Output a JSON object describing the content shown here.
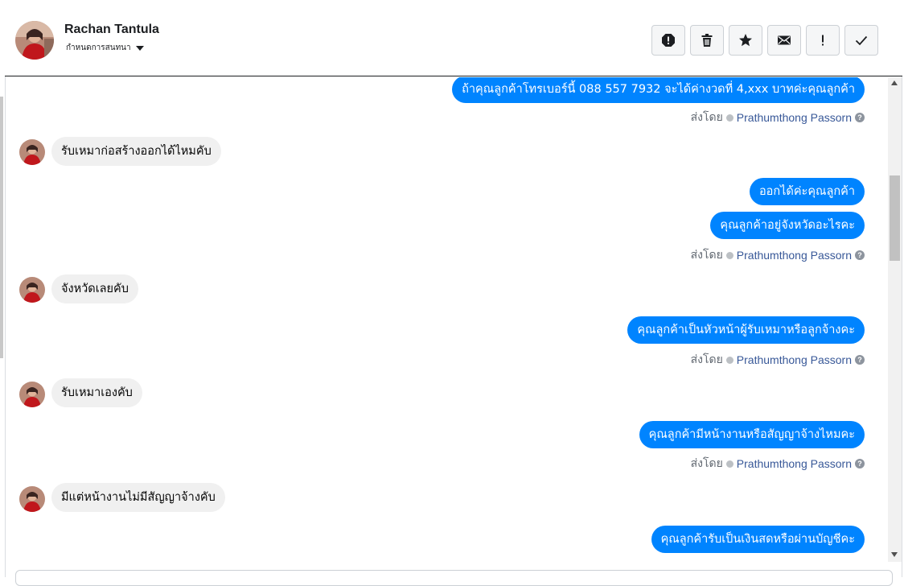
{
  "header": {
    "contact_name": "Rachan Tantula",
    "contact_sub": "กำหนดการสนทนา",
    "actions": [
      {
        "name": "spam-icon"
      },
      {
        "name": "trash-icon"
      },
      {
        "name": "star-icon"
      },
      {
        "name": "mail-icon"
      },
      {
        "name": "mark-important-icon"
      },
      {
        "name": "check-icon"
      }
    ]
  },
  "sent_by": {
    "label": "ส่งโดย",
    "agent": "Prathumthong Passorn",
    "help": "?"
  },
  "messages": {
    "m1": "ถ้าคุณลูกค้าโทรเบอร์นี้ 088 557 7932 จะได้ค่างวดที่ 4,xxx บาทค่ะคุณลูกค้า",
    "m2": "รับเหมาก่อสร้างออกได้ไหมคับ",
    "m3": "ออกได้ค่ะคุณลูกค้า",
    "m4": "คุณลูกค้าอยู่จังหวัดอะไรคะ",
    "m5": "จังหวัดเลยคับ",
    "m6": "คุณลูกค้าเป็นหัวหน้าผู้รับเหมาหรือลูกจ้างคะ",
    "m7": "รับเหมาเองคับ",
    "m8": "คุณลูกค้ามีหน้างานหรือสัญญาจ้างไหมคะ",
    "m9": "มีแต่หน้างานไม่มีสัญญาจ้างคับ",
    "m10": "คุณลูกค้ารับเป็นเงินสดหรือผ่านบัญชีคะ"
  },
  "colors": {
    "outgoing_bubble": "#0084ff",
    "incoming_bubble": "#f0f0f0",
    "agent_link": "#385898"
  }
}
